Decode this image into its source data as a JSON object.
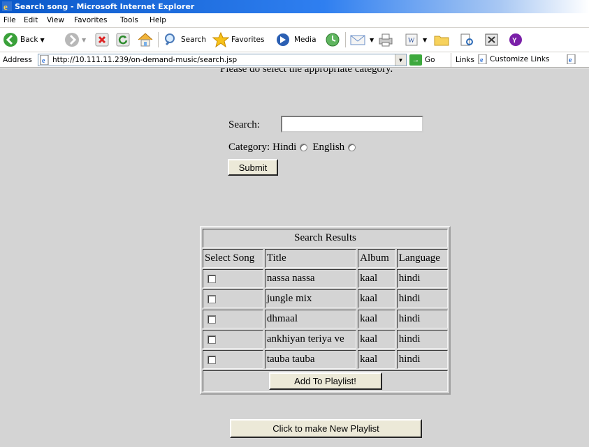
{
  "window": {
    "title": "Search song - Microsoft Internet Explorer"
  },
  "menu": [
    "File",
    "Edit",
    "View",
    "Favorites",
    "Tools",
    "Help"
  ],
  "toolbar": {
    "back_label": "Back",
    "search_label": "Search",
    "favorites_label": "Favorites",
    "media_label": "Media"
  },
  "address": {
    "label": "Address",
    "url": "http://10.111.11.239/on-demand-music/search.jsp",
    "go_label": "Go",
    "links_label": "Links",
    "customize_links": "Customize Links"
  },
  "page": {
    "intro": "Please do select the appropriate category.",
    "search_label": "Search:",
    "search_value": "",
    "category_label": "Category:",
    "category_options": [
      "Hindi",
      "English"
    ],
    "submit_label": "Submit",
    "results": {
      "caption": "Search Results",
      "columns": [
        "Select Song",
        "Title",
        "Album",
        "Language"
      ],
      "rows": [
        {
          "title": "nassa nassa",
          "album": "kaal",
          "language": "hindi"
        },
        {
          "title": "jungle mix",
          "album": "kaal",
          "language": "hindi"
        },
        {
          "title": "dhmaal",
          "album": "kaal",
          "language": "hindi"
        },
        {
          "title": "ankhiyan teriya ve",
          "album": "kaal",
          "language": "hindi"
        },
        {
          "title": "tauba tauba",
          "album": "kaal",
          "language": "hindi"
        }
      ],
      "add_button": "Add To Playlist!"
    },
    "new_playlist_button": "Click to make New Playlist"
  },
  "colors": {
    "titlebar": "#0a58c9",
    "page_background": "#d4d4d4",
    "button_face": "#ece9d8"
  }
}
